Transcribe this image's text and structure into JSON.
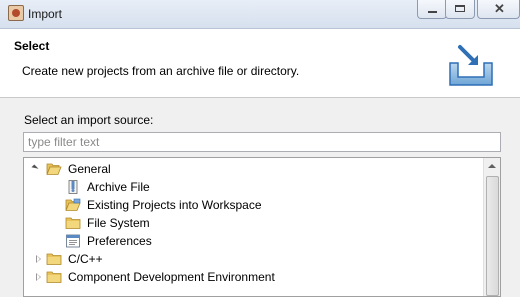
{
  "window": {
    "title": "Import",
    "controls": [
      "minimize",
      "maximize",
      "close"
    ]
  },
  "banner": {
    "title": "Select",
    "description": "Create new projects from an archive file or directory.",
    "icon": "import-tray-icon"
  },
  "source": {
    "label": "Select an import source:",
    "filter_placeholder": "type filter text",
    "filter_value": ""
  },
  "tree": {
    "items": [
      {
        "label": "General",
        "expanded": true,
        "icon": "folder-open-icon",
        "depth": 0
      },
      {
        "label": "Archive File",
        "icon": "archive-file-icon",
        "depth": 1
      },
      {
        "label": "Existing Projects into Workspace",
        "icon": "project-folder-icon",
        "depth": 1
      },
      {
        "label": "File System",
        "icon": "folder-icon",
        "depth": 1
      },
      {
        "label": "Preferences",
        "icon": "preferences-icon",
        "depth": 1
      },
      {
        "label": "C/C++",
        "expanded": false,
        "icon": "folder-icon",
        "depth": 0
      },
      {
        "label": "Component Development Environment",
        "expanded": false,
        "icon": "folder-icon",
        "depth": 0
      }
    ]
  },
  "colors": {
    "folder": "#e8c25a",
    "accent": "#2f6fb5",
    "titlebar": "#dbe4f1"
  }
}
